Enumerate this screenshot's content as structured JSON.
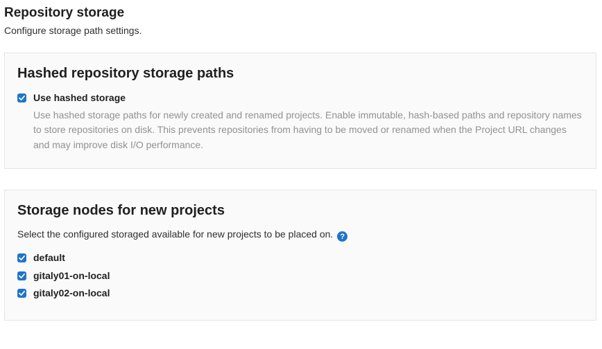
{
  "page": {
    "title": "Repository storage",
    "subtitle": "Configure storage path settings."
  },
  "hashed_panel": {
    "title": "Hashed repository storage paths",
    "checkbox_label": "Use hashed storage",
    "checkbox_checked": true,
    "help_text": "Use hashed storage paths for newly created and renamed projects. Enable immutable, hash-based paths and repository names to store repositories on disk. This prevents repositories from having to be moved or renamed when the Project URL changes and may improve disk I/O performance."
  },
  "nodes_panel": {
    "title": "Storage nodes for new projects",
    "description": "Select the configured storaged available for new projects to be placed on.",
    "help_icon_label": "?",
    "nodes": [
      {
        "label": "default",
        "checked": true
      },
      {
        "label": "gitaly01-on-local",
        "checked": true
      },
      {
        "label": "gitaly02-on-local",
        "checked": true
      }
    ]
  }
}
